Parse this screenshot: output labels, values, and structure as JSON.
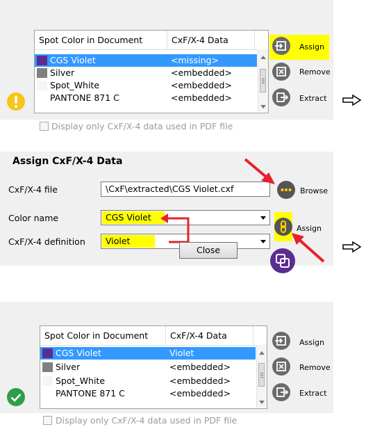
{
  "colors": {
    "highlight": "#ffff00",
    "selection": "#3399ff",
    "arrow_red": "#e8202a",
    "violet": "#5b2d90",
    "warning": "#f5c518",
    "success": "#2e9e4a"
  },
  "table_header": {
    "col1": "Spot Color in Document",
    "col2": "CxF/X-4 Data"
  },
  "table_before": {
    "rows": [
      {
        "name": "CGS Violet",
        "data": "<missing>",
        "swatch": "#5b2d90",
        "selected": true
      },
      {
        "name": "Silver",
        "data": "<embedded>",
        "swatch": "#808080",
        "selected": false
      },
      {
        "name": "Spot_White",
        "data": "<embedded>",
        "swatch": "#f5f5f5",
        "selected": false
      },
      {
        "name": "PANTONE 871 C",
        "data": "<embedded>",
        "swatch": "none",
        "selected": false
      }
    ]
  },
  "table_after": {
    "rows": [
      {
        "name": "CGS Violet",
        "data": "Violet",
        "swatch": "#5b2d90",
        "selected": true
      },
      {
        "name": "Silver",
        "data": "<embedded>",
        "swatch": "#808080",
        "selected": false
      },
      {
        "name": "Spot_White",
        "data": "<embedded>",
        "swatch": "#f5f5f5",
        "selected": false
      },
      {
        "name": "PANTONE 871 C",
        "data": "<embedded>",
        "swatch": "none",
        "selected": false
      }
    ]
  },
  "side_buttons": {
    "assign": "Assign",
    "remove": "Remove",
    "extract": "Extract"
  },
  "checkbox_label": "Display only CxF/X-4 data used in PDF file",
  "dialog": {
    "title": "Assign CxF/X-4 Data",
    "file_label": "CxF/X-4 file",
    "file_value": "\\CxF\\extracted\\CGS Violet.cxf",
    "browse_label": "Browse",
    "color_name_label": "Color name",
    "color_name_value": "CGS Violet",
    "definition_label": "CxF/X-4 definition",
    "definition_value": "Violet",
    "assign_label": "Assign",
    "close_label": "Close"
  },
  "icons": [
    "warning-icon",
    "assign-icon",
    "remove-icon",
    "extract-icon",
    "next-arrow-icon",
    "browse-icon",
    "link-icon",
    "copy-icon",
    "checkmark-icon",
    "red-pointer-arrow"
  ]
}
